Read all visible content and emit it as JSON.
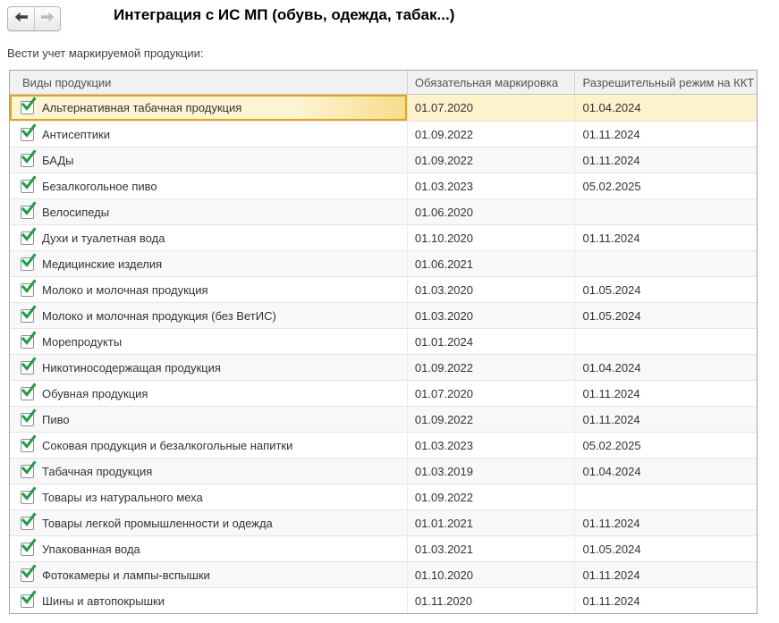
{
  "window": {
    "title": "Интеграция с ИС МП (обувь, одежда, табак...)",
    "subtitle": "Вести учет маркируемой продукции:"
  },
  "nav": {
    "back_icon": "arrow-left",
    "forward_icon": "arrow-right",
    "back_enabled": true,
    "forward_enabled": false
  },
  "colors": {
    "selection_background": "#FCF2CC",
    "selection_cell_border": "#DFA61D",
    "checkbox_check_green": "#1E9E44",
    "header_background": "#F1F1F1",
    "alt_row_background": "#F8F8F8",
    "enabled_arrow": "#3F3F3F",
    "disabled_arrow": "#BBBBBB"
  },
  "table": {
    "columns": [
      "Виды продукции",
      "Обязательная маркировка",
      "Разрешительный режим на ККТ"
    ],
    "rows": [
      {
        "name": "Альтернативная табачная продукция",
        "checked": true,
        "mandatory_marking": "01.07.2020",
        "kkt_permission": "01.04.2024",
        "selected": true
      },
      {
        "name": "Антисептики",
        "checked": true,
        "mandatory_marking": "01.09.2022",
        "kkt_permission": "01.11.2024",
        "selected": false
      },
      {
        "name": "БАДы",
        "checked": true,
        "mandatory_marking": "01.09.2022",
        "kkt_permission": "01.11.2024",
        "selected": false
      },
      {
        "name": "Безалкогольное пиво",
        "checked": true,
        "mandatory_marking": "01.03.2023",
        "kkt_permission": "05.02.2025",
        "selected": false
      },
      {
        "name": "Велосипеды",
        "checked": true,
        "mandatory_marking": "01.06.2020",
        "kkt_permission": "",
        "selected": false
      },
      {
        "name": "Духи и туалетная вода",
        "checked": true,
        "mandatory_marking": "01.10.2020",
        "kkt_permission": "01.11.2024",
        "selected": false
      },
      {
        "name": "Медицинские изделия",
        "checked": true,
        "mandatory_marking": "01.06.2021",
        "kkt_permission": "",
        "selected": false
      },
      {
        "name": "Молоко и молочная продукция",
        "checked": true,
        "mandatory_marking": "01.03.2020",
        "kkt_permission": "01.05.2024",
        "selected": false
      },
      {
        "name": "Молоко и молочная продукция (без ВетИС)",
        "checked": true,
        "mandatory_marking": "01.03.2020",
        "kkt_permission": "01.05.2024",
        "selected": false
      },
      {
        "name": "Морепродукты",
        "checked": true,
        "mandatory_marking": "01.01.2024",
        "kkt_permission": "",
        "selected": false
      },
      {
        "name": "Никотиносодержащая продукция",
        "checked": true,
        "mandatory_marking": "01.09.2022",
        "kkt_permission": "01.04.2024",
        "selected": false
      },
      {
        "name": "Обувная продукция",
        "checked": true,
        "mandatory_marking": "01.07.2020",
        "kkt_permission": "01.11.2024",
        "selected": false
      },
      {
        "name": "Пиво",
        "checked": true,
        "mandatory_marking": "01.09.2022",
        "kkt_permission": "01.11.2024",
        "selected": false
      },
      {
        "name": "Соковая продукция и безалкогольные напитки",
        "checked": true,
        "mandatory_marking": "01.03.2023",
        "kkt_permission": "05.02.2025",
        "selected": false
      },
      {
        "name": "Табачная продукция",
        "checked": true,
        "mandatory_marking": "01.03.2019",
        "kkt_permission": "01.04.2024",
        "selected": false
      },
      {
        "name": "Товары из натурального меха",
        "checked": true,
        "mandatory_marking": "01.09.2022",
        "kkt_permission": "",
        "selected": false
      },
      {
        "name": "Товары легкой промышленности и одежда",
        "checked": true,
        "mandatory_marking": "01.01.2021",
        "kkt_permission": "01.11.2024",
        "selected": false
      },
      {
        "name": "Упакованная вода",
        "checked": true,
        "mandatory_marking": "01.03.2021",
        "kkt_permission": "01.05.2024",
        "selected": false
      },
      {
        "name": "Фотокамеры и лампы-вспышки",
        "checked": true,
        "mandatory_marking": "01.10.2020",
        "kkt_permission": "01.11.2024",
        "selected": false
      },
      {
        "name": "Шины и автопокрышки",
        "checked": true,
        "mandatory_marking": "01.11.2020",
        "kkt_permission": "01.11.2024",
        "selected": false
      }
    ]
  }
}
